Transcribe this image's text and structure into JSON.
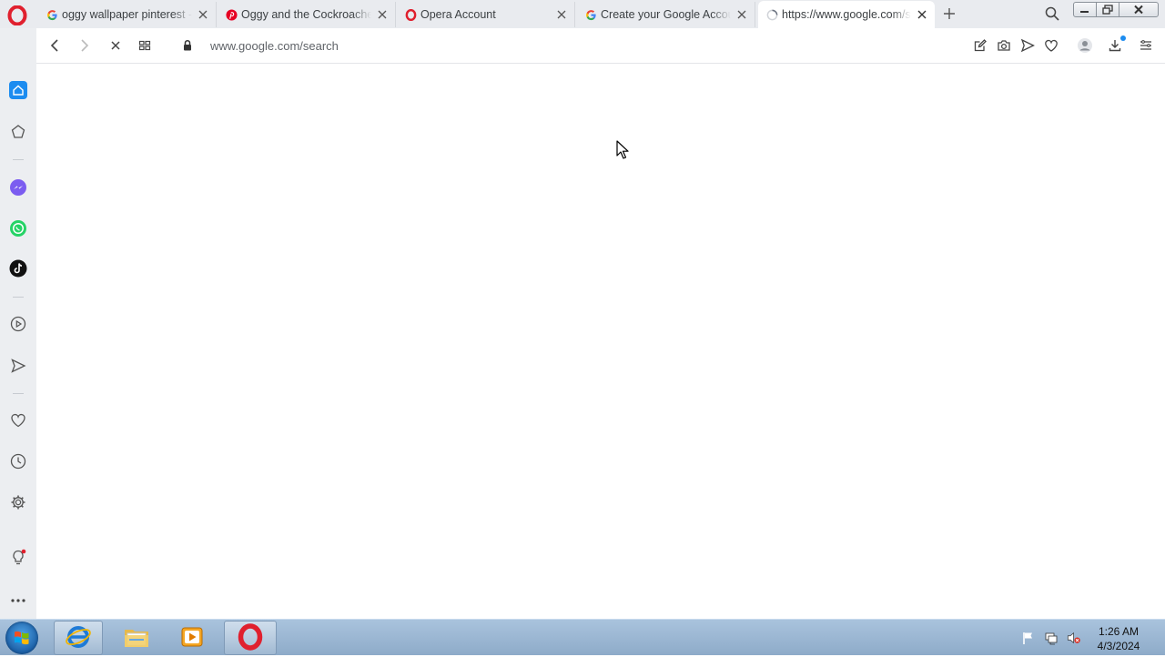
{
  "tabs": [
    {
      "title": "oggy wallpaper pinterest - Google",
      "favicon": "google-icon",
      "active": false
    },
    {
      "title": "Oggy and the Cockroaches",
      "favicon": "pinterest-icon",
      "active": false
    },
    {
      "title": "Opera Account",
      "favicon": "opera-icon",
      "active": false
    },
    {
      "title": "Create your Google Account",
      "favicon": "google-icon",
      "active": false
    },
    {
      "title": "https://www.google.com/search",
      "favicon": "loading-spinner-icon",
      "active": true
    }
  ],
  "address_bar": {
    "host": "www.google.com",
    "path": "/search",
    "secure": true,
    "loading": true
  },
  "sidebar": {
    "items": [
      "home-icon",
      "speed-dial-icon",
      "messenger-icon",
      "whatsapp-icon",
      "tiktok-icon",
      "player-icon",
      "send-icon",
      "heart-icon",
      "history-icon",
      "settings-icon",
      "tips-icon",
      "more-icon"
    ]
  },
  "taskbar": {
    "apps": [
      "internet-explorer-icon",
      "file-explorer-icon",
      "media-player-icon",
      "opera-icon"
    ],
    "clock_time": "1:26 AM",
    "clock_date": "4/3/2024"
  },
  "colors": {
    "opera_red": "#e0202e",
    "accent_blue": "#1c8cf0",
    "tabstrip_bg": "#e9ebef",
    "sidebar_bg": "#eceef1"
  }
}
